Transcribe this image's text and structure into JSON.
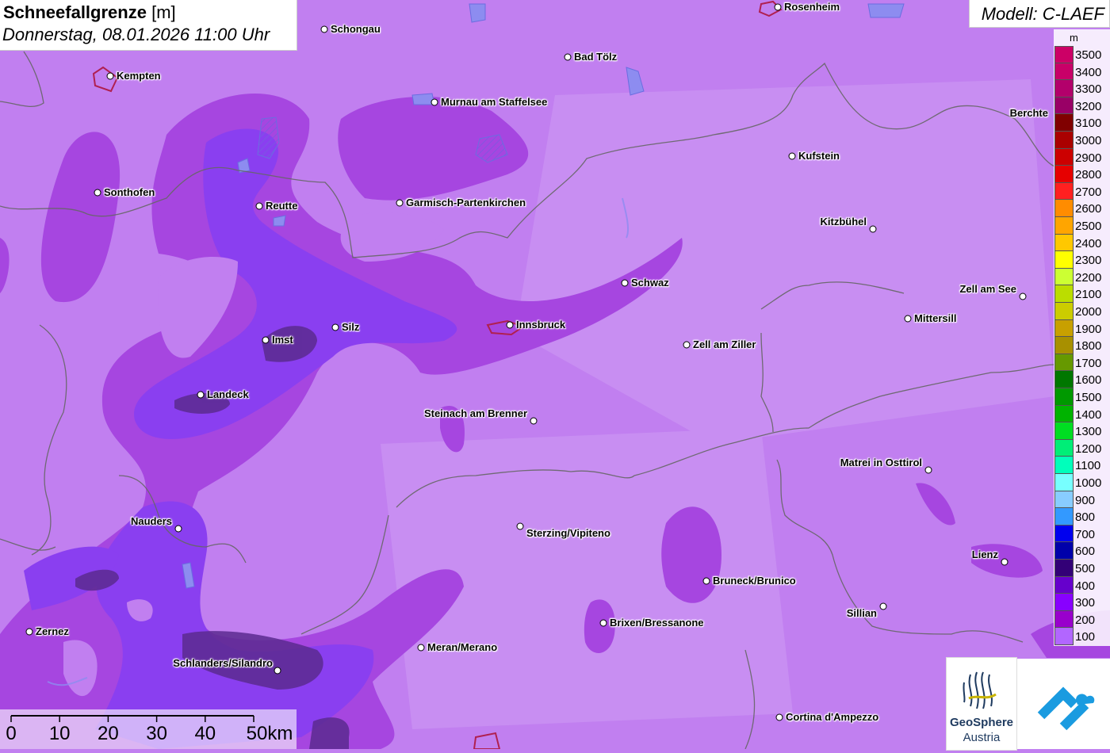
{
  "title": {
    "main": "Schneefallgrenze",
    "unit": "[m]",
    "subtitle": "Donnerstag, 08.01.2026 11:00 Uhr"
  },
  "model": "Modell: C-LAEF",
  "legend": {
    "unit": "m",
    "entries": [
      {
        "label": "3500",
        "color": "#cc0066"
      },
      {
        "label": "3400",
        "color": "#c80068"
      },
      {
        "label": "3300",
        "color": "#b3006b"
      },
      {
        "label": "3200",
        "color": "#990066"
      },
      {
        "label": "3100",
        "color": "#800000"
      },
      {
        "label": "3000",
        "color": "#aa0000"
      },
      {
        "label": "2900",
        "color": "#cc0000"
      },
      {
        "label": "2800",
        "color": "#e60000"
      },
      {
        "label": "2700",
        "color": "#ff2020"
      },
      {
        "label": "2600",
        "color": "#ff8c00"
      },
      {
        "label": "2500",
        "color": "#ffa500"
      },
      {
        "label": "2400",
        "color": "#ffc800"
      },
      {
        "label": "2300",
        "color": "#ffff00"
      },
      {
        "label": "2200",
        "color": "#ccff33"
      },
      {
        "label": "2100",
        "color": "#bbdd00"
      },
      {
        "label": "2000",
        "color": "#cccc00"
      },
      {
        "label": "1900",
        "color": "#c8a000"
      },
      {
        "label": "1800",
        "color": "#a89000"
      },
      {
        "label": "1700",
        "color": "#669900"
      },
      {
        "label": "1600",
        "color": "#007700"
      },
      {
        "label": "1500",
        "color": "#009900"
      },
      {
        "label": "1400",
        "color": "#00b300"
      },
      {
        "label": "1300",
        "color": "#00dd22"
      },
      {
        "label": "1200",
        "color": "#00ee77"
      },
      {
        "label": "1100",
        "color": "#00ffbb"
      },
      {
        "label": "1000",
        "color": "#77ffff"
      },
      {
        "label": "900",
        "color": "#88ccff"
      },
      {
        "label": "800",
        "color": "#3399ff"
      },
      {
        "label": "700",
        "color": "#0000ee"
      },
      {
        "label": "600",
        "color": "#0000aa"
      },
      {
        "label": "500",
        "color": "#330077"
      },
      {
        "label": "400",
        "color": "#6600cc"
      },
      {
        "label": "300",
        "color": "#8800ff"
      },
      {
        "label": "200",
        "color": "#9900cc"
      },
      {
        "label": "100",
        "color": "#b266ff"
      }
    ]
  },
  "cities": [
    {
      "name": "Schongau"
    },
    {
      "name": "Rosenheim"
    },
    {
      "name": "Kempten"
    },
    {
      "name": "Bad Tölz"
    },
    {
      "name": "Murnau am Staffelsee"
    },
    {
      "name": "Berchte"
    },
    {
      "name": "Kufstein"
    },
    {
      "name": "Sonthofen"
    },
    {
      "name": "Reutte"
    },
    {
      "name": "Garmisch-Partenkirchen"
    },
    {
      "name": "Kitzbühel"
    },
    {
      "name": "Schwaz"
    },
    {
      "name": "Zell am See"
    },
    {
      "name": "Mittersill"
    },
    {
      "name": "Innsbruck"
    },
    {
      "name": "Imst"
    },
    {
      "name": "Silz"
    },
    {
      "name": "Zell am Ziller"
    },
    {
      "name": "Landeck"
    },
    {
      "name": "Steinach am Brenner"
    },
    {
      "name": "Matrei in Osttirol"
    },
    {
      "name": "Nauders"
    },
    {
      "name": "Sterzing/Vipiteno"
    },
    {
      "name": "Lienz"
    },
    {
      "name": "Bruneck/Brunico"
    },
    {
      "name": "Sillian"
    },
    {
      "name": "Brixen/Bressanone"
    },
    {
      "name": "Zernez"
    },
    {
      "name": "Meran/Merano"
    },
    {
      "name": "Schlanders/Silandro"
    },
    {
      "name": "Cortina d'Ampezzo"
    }
  ],
  "scale": {
    "labels": [
      "0",
      "10",
      "20",
      "30",
      "40",
      "50km"
    ]
  },
  "logo": {
    "name": "GeoSphere",
    "sub": "Austria"
  },
  "colors": {
    "base": "#c17ff0",
    "band_200": "#a646e0",
    "band_300": "#8a3ff0",
    "band_500": "#5a2a8f",
    "logo_blue": "#1e3a5f",
    "app_blue": "#1a9be0"
  }
}
